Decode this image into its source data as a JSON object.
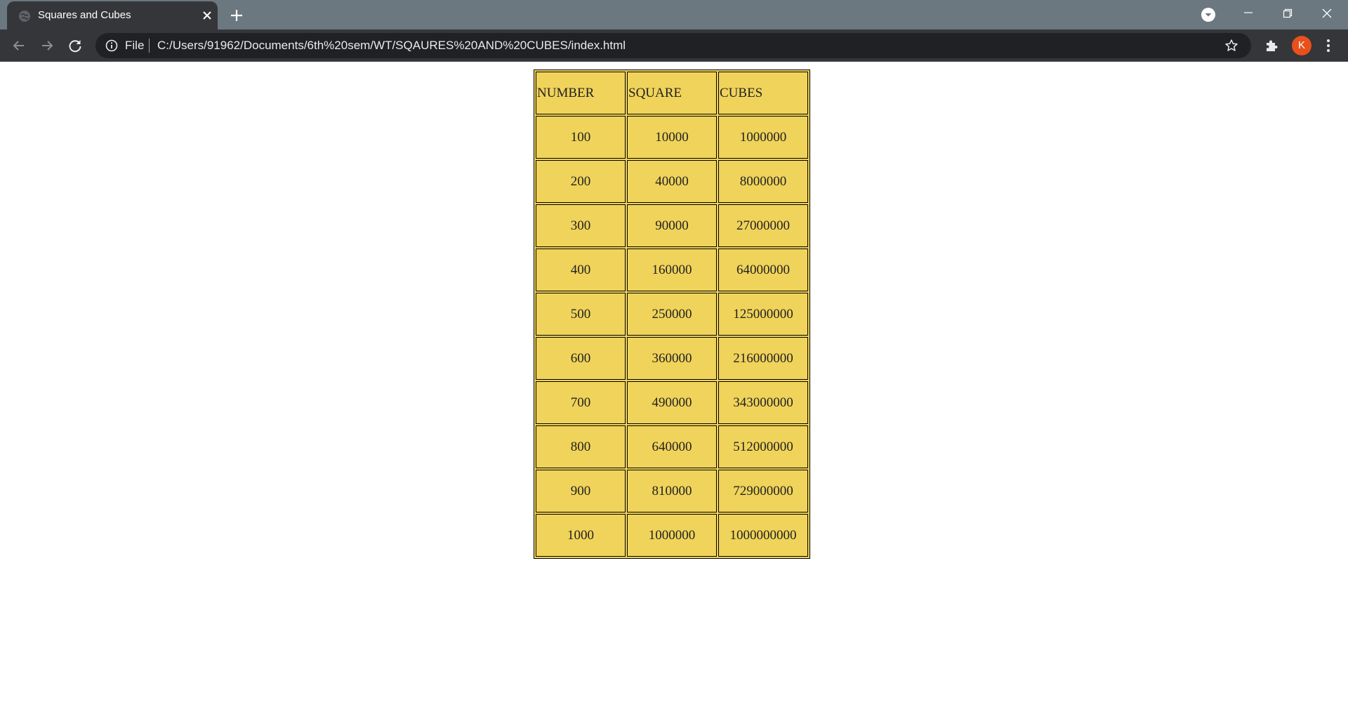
{
  "browser": {
    "tab": {
      "title": "Squares and Cubes"
    },
    "omnibox": {
      "scheme_label": "File",
      "url": "C:/Users/91962/Documents/6th%20sem/WT/SQAURES%20AND%20CUBES/index.html"
    },
    "profile": {
      "initial": "K",
      "color": "#e8501c"
    }
  },
  "icons": {
    "tab_favicon": "globe-icon",
    "tab_close": "close-icon",
    "new_tab": "plus-icon",
    "tab_search": "chevron-down-circle-icon",
    "back": "arrow-left-icon",
    "forward": "arrow-right-icon",
    "reload": "reload-icon",
    "site_info": "info-icon",
    "bookmark": "star-icon",
    "extensions": "puzzle-icon",
    "menu": "kebab-menu-icon"
  },
  "colors": {
    "tabstrip_bg": "#6b787f",
    "toolbar_bg": "#35363a",
    "omnibox_bg": "#202124",
    "table_bg": "#f0d35a"
  },
  "table": {
    "headers": [
      "NUMBER",
      "SQUARE",
      "CUBES"
    ],
    "rows": [
      [
        "100",
        "10000",
        "1000000"
      ],
      [
        "200",
        "40000",
        "8000000"
      ],
      [
        "300",
        "90000",
        "27000000"
      ],
      [
        "400",
        "160000",
        "64000000"
      ],
      [
        "500",
        "250000",
        "125000000"
      ],
      [
        "600",
        "360000",
        "216000000"
      ],
      [
        "700",
        "490000",
        "343000000"
      ],
      [
        "800",
        "640000",
        "512000000"
      ],
      [
        "900",
        "810000",
        "729000000"
      ],
      [
        "1000",
        "1000000",
        "1000000000"
      ]
    ]
  }
}
